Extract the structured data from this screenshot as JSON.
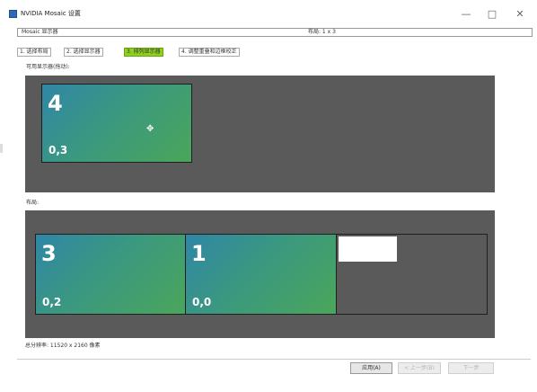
{
  "window": {
    "title": "NVIDIA Mosaic 设置",
    "minimize_glyph": "—",
    "maximize_glyph": "□",
    "close_glyph": "✕"
  },
  "header": {
    "mosaic_label": "Mosaic 显示器",
    "layout_label": "布局: 1 x 3"
  },
  "steps": [
    {
      "label": "1. 选择布局"
    },
    {
      "label": "2. 选择显示器"
    },
    {
      "label": "3. 排列显示器"
    },
    {
      "label": "4. 调整重叠和边框校正"
    }
  ],
  "available": {
    "label": "可用显示器(拖动):",
    "monitors": [
      {
        "number": "4",
        "position": "0,3"
      }
    ]
  },
  "layout": {
    "label": "布局:",
    "monitors": [
      {
        "number": "3",
        "position": "0,2"
      },
      {
        "number": "1",
        "position": "0,0"
      }
    ]
  },
  "total_resolution": "总分辨率:  11520 x 2160 像素",
  "buttons": {
    "apply": "应用(A)",
    "prev": "< 上一步(B)",
    "next": "下一步"
  }
}
